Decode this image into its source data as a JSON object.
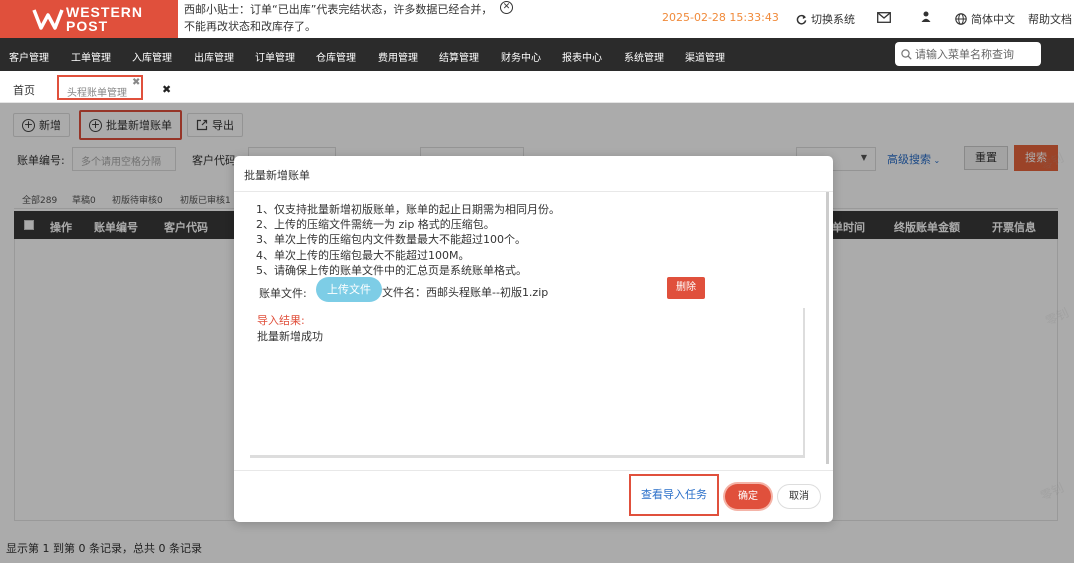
{
  "brand": {
    "line1": "WESTERN",
    "line2": "POST",
    "color": "#e0503c"
  },
  "tip": {
    "text": "西邮小贴士：订单“已出库”代表完结状态，许多数据已经合并，不能再改状态和改库存了。"
  },
  "clock": "2025-02-28 15:33:43",
  "topbar": {
    "switch_system": "切换系统",
    "language": "简体中文",
    "help": "帮助文档"
  },
  "nav": {
    "items": [
      "客户管理",
      "工单管理",
      "入库管理",
      "出库管理",
      "订单管理",
      "仓库管理",
      "费用管理",
      "结算管理",
      "财务中心",
      "报表中心",
      "系统管理",
      "渠道管理"
    ],
    "search_placeholder": "请输入菜单名称查询"
  },
  "tabs": {
    "home": "首页",
    "active": "头程账单管理"
  },
  "toolbar": {
    "add": "新增",
    "batch_add": "批量新增账单",
    "export": "导出"
  },
  "filters": {
    "bill_no_label": "账单编号:",
    "bill_no_placeholder": "多个请用空格分隔",
    "customer_code_label": "客户代码",
    "advanced_search": "高级搜索",
    "reset": "重置",
    "search": "搜索"
  },
  "subtabs": [
    "全部289",
    "草稿0",
    "初版待审核0",
    "初版已审核1"
  ],
  "table": {
    "columns": [
      "操作",
      "账单编号",
      "客户代码"
    ],
    "columns_right": [
      "单时间",
      "终版账单金额",
      "开票信息"
    ]
  },
  "footer": "显示第 1 到第 0 条记录，总共 0 条记录",
  "watermark": "零钊",
  "modal": {
    "title": "批量新增账单",
    "instructions": [
      "1、仅支持批量新增初版账单，账单的起止日期需为相同月份。",
      "2、上传的压缩文件需统一为 zip 格式的压缩包。",
      "3、单次上传的压缩包内文件数量最大不能超过100个。",
      "4、单次上传的压缩包最大不能超过100M。",
      "5、请确保上传的账单文件中的汇总页是系统账单格式。"
    ],
    "file_label": "账单文件:",
    "upload_button": "上传文件",
    "file_name": "文件名：西邮头程账单--初版1.zip",
    "delete_button": "删除",
    "result_title": "导入结果:",
    "result_text": "批量新增成功",
    "view_task_button": "查看导入任务",
    "ok_button": "确定",
    "cancel_button": "取消"
  }
}
